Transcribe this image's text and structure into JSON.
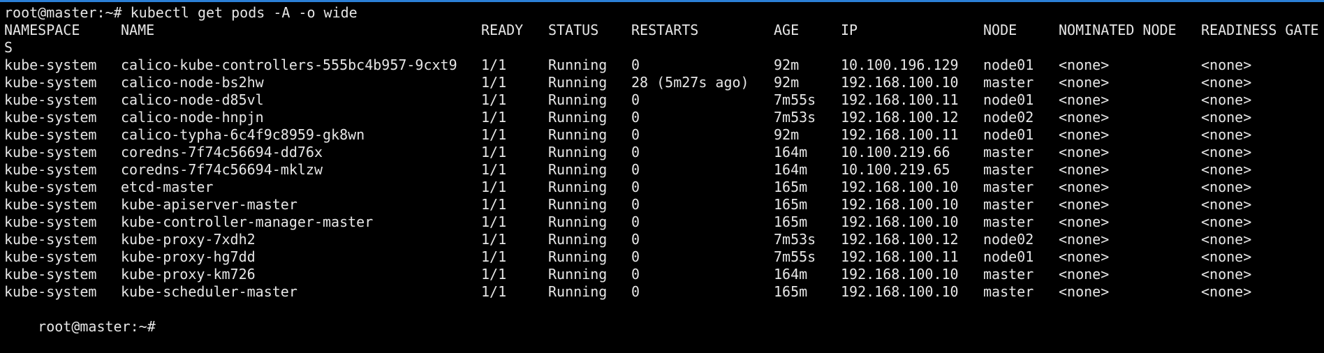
{
  "terminal": {
    "accent_color": "#2b7fd6",
    "command_line": "root@master:~# kubectl get pods -A -o wide",
    "prompt": "root@master:~# ",
    "headers": {
      "namespace": "NAMESPACE",
      "name": "NAME",
      "ready": "READY",
      "status": "STATUS",
      "restarts": "RESTARTS",
      "age": "AGE",
      "ip": "IP",
      "node": "NODE",
      "nominated_node": "NOMINATED NODE",
      "readiness_gates": "READINESS GATE",
      "readiness_gates_wrap": "S"
    },
    "rows": [
      {
        "namespace": "kube-system",
        "name": "calico-kube-controllers-555bc4b957-9cxt9",
        "ready": "1/1",
        "status": "Running",
        "restarts": "0",
        "age": "92m",
        "ip": "10.100.196.129",
        "node": "node01",
        "nominated": "<none>",
        "readiness": "<none>"
      },
      {
        "namespace": "kube-system",
        "name": "calico-node-bs2hw",
        "ready": "1/1",
        "status": "Running",
        "restarts": "28 (5m27s ago)",
        "age": "92m",
        "ip": "192.168.100.10",
        "node": "master",
        "nominated": "<none>",
        "readiness": "<none>"
      },
      {
        "namespace": "kube-system",
        "name": "calico-node-d85vl",
        "ready": "1/1",
        "status": "Running",
        "restarts": "0",
        "age": "7m55s",
        "ip": "192.168.100.11",
        "node": "node01",
        "nominated": "<none>",
        "readiness": "<none>"
      },
      {
        "namespace": "kube-system",
        "name": "calico-node-hnpjn",
        "ready": "1/1",
        "status": "Running",
        "restarts": "0",
        "age": "7m53s",
        "ip": "192.168.100.12",
        "node": "node02",
        "nominated": "<none>",
        "readiness": "<none>"
      },
      {
        "namespace": "kube-system",
        "name": "calico-typha-6c4f9c8959-gk8wn",
        "ready": "1/1",
        "status": "Running",
        "restarts": "0",
        "age": "92m",
        "ip": "192.168.100.11",
        "node": "node01",
        "nominated": "<none>",
        "readiness": "<none>"
      },
      {
        "namespace": "kube-system",
        "name": "coredns-7f74c56694-dd76x",
        "ready": "1/1",
        "status": "Running",
        "restarts": "0",
        "age": "164m",
        "ip": "10.100.219.66",
        "node": "master",
        "nominated": "<none>",
        "readiness": "<none>"
      },
      {
        "namespace": "kube-system",
        "name": "coredns-7f74c56694-mklzw",
        "ready": "1/1",
        "status": "Running",
        "restarts": "0",
        "age": "164m",
        "ip": "10.100.219.65",
        "node": "master",
        "nominated": "<none>",
        "readiness": "<none>"
      },
      {
        "namespace": "kube-system",
        "name": "etcd-master",
        "ready": "1/1",
        "status": "Running",
        "restarts": "0",
        "age": "165m",
        "ip": "192.168.100.10",
        "node": "master",
        "nominated": "<none>",
        "readiness": "<none>"
      },
      {
        "namespace": "kube-system",
        "name": "kube-apiserver-master",
        "ready": "1/1",
        "status": "Running",
        "restarts": "0",
        "age": "165m",
        "ip": "192.168.100.10",
        "node": "master",
        "nominated": "<none>",
        "readiness": "<none>"
      },
      {
        "namespace": "kube-system",
        "name": "kube-controller-manager-master",
        "ready": "1/1",
        "status": "Running",
        "restarts": "0",
        "age": "165m",
        "ip": "192.168.100.10",
        "node": "master",
        "nominated": "<none>",
        "readiness": "<none>"
      },
      {
        "namespace": "kube-system",
        "name": "kube-proxy-7xdh2",
        "ready": "1/1",
        "status": "Running",
        "restarts": "0",
        "age": "7m53s",
        "ip": "192.168.100.12",
        "node": "node02",
        "nominated": "<none>",
        "readiness": "<none>"
      },
      {
        "namespace": "kube-system",
        "name": "kube-proxy-hg7dd",
        "ready": "1/1",
        "status": "Running",
        "restarts": "0",
        "age": "7m55s",
        "ip": "192.168.100.11",
        "node": "node01",
        "nominated": "<none>",
        "readiness": "<none>"
      },
      {
        "namespace": "kube-system",
        "name": "kube-proxy-km726",
        "ready": "1/1",
        "status": "Running",
        "restarts": "0",
        "age": "164m",
        "ip": "192.168.100.10",
        "node": "master",
        "nominated": "<none>",
        "readiness": "<none>"
      },
      {
        "namespace": "kube-system",
        "name": "kube-scheduler-master",
        "ready": "1/1",
        "status": "Running",
        "restarts": "0",
        "age": "165m",
        "ip": "192.168.100.10",
        "node": "master",
        "nominated": "<none>",
        "readiness": "<none>"
      }
    ]
  }
}
